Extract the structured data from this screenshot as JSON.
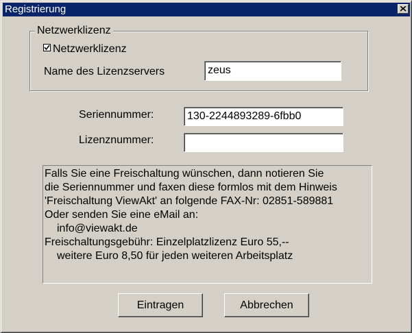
{
  "window": {
    "title": "Registrierung",
    "close_label": "×"
  },
  "group": {
    "legend": "Netzwerklizenz",
    "checkbox_label": "Netzwerklizenz",
    "checkbox_checked": true,
    "server_label": "Name des Lizenzservers",
    "server_value": "zeus"
  },
  "serial": {
    "label": "Seriennummer:",
    "value": "130-2244893289-6fbb0"
  },
  "license": {
    "label": "Lizenznummer:",
    "value": ""
  },
  "info": {
    "lines": [
      "Falls Sie eine Freischaltung wünschen, dann notieren Sie",
      "die Seriennummer und faxen diese formlos mit dem Hinweis",
      "'Freischaltung ViewAkt' an folgende FAX-Nr: 02851-589881",
      "Oder senden Sie eine eMail an:",
      "info@viewakt.de",
      "Freischaltungsgebühr: Einzelplatzlizenz Euro 55,--",
      "weitere Euro 8,50 für jeden weiteren Arbeitsplatz"
    ]
  },
  "buttons": {
    "ok": "Eintragen",
    "cancel": "Abbrechen"
  }
}
